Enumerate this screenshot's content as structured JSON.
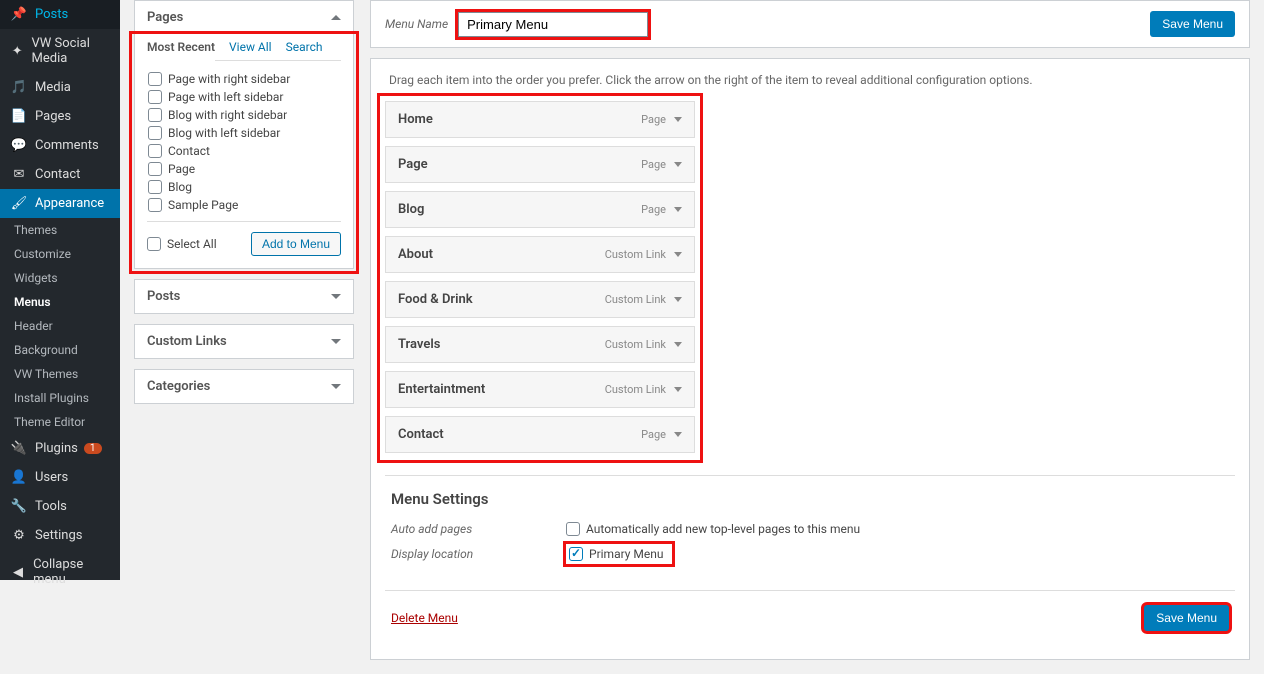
{
  "sidebar": {
    "items": [
      {
        "label": "Posts",
        "icon": "pin"
      },
      {
        "label": "VW Social Media",
        "icon": "star"
      },
      {
        "label": "Media",
        "icon": "media"
      },
      {
        "label": "Pages",
        "icon": "page"
      },
      {
        "label": "Comments",
        "icon": "comment"
      },
      {
        "label": "Contact",
        "icon": "mail"
      },
      {
        "label": "Appearance",
        "icon": "brush",
        "active": true
      },
      {
        "label": "Plugins",
        "icon": "plug",
        "badge": "1"
      },
      {
        "label": "Users",
        "icon": "user"
      },
      {
        "label": "Tools",
        "icon": "wrench"
      },
      {
        "label": "Settings",
        "icon": "gear"
      },
      {
        "label": "Collapse menu",
        "icon": "collapse"
      }
    ],
    "subs": [
      {
        "label": "Themes"
      },
      {
        "label": "Customize"
      },
      {
        "label": "Widgets"
      },
      {
        "label": "Menus",
        "current": true
      },
      {
        "label": "Header"
      },
      {
        "label": "Background"
      },
      {
        "label": "VW Themes"
      },
      {
        "label": "Install Plugins"
      },
      {
        "label": "Theme Editor"
      }
    ]
  },
  "left": {
    "pages_title": "Pages",
    "tabs": {
      "recent": "Most Recent",
      "view_all": "View All",
      "search": "Search"
    },
    "page_items": [
      "Page with right sidebar",
      "Page with left sidebar",
      "Blog with right sidebar",
      "Blog with left sidebar",
      "Contact",
      "Page",
      "Blog",
      "Sample Page"
    ],
    "select_all": "Select All",
    "add_btn": "Add to Menu",
    "other_boxes": [
      "Posts",
      "Custom Links",
      "Categories"
    ]
  },
  "editor": {
    "menu_name_label": "Menu Name",
    "menu_name_value": "Primary Menu",
    "save_label": "Save Menu",
    "instructions": "Drag each item into the order you prefer. Click the arrow on the right of the item to reveal additional configuration options.",
    "items": [
      {
        "title": "Home",
        "type": "Page"
      },
      {
        "title": "Page",
        "type": "Page"
      },
      {
        "title": "Blog",
        "type": "Page"
      },
      {
        "title": "About",
        "type": "Custom Link"
      },
      {
        "title": "Food & Drink",
        "type": "Custom Link"
      },
      {
        "title": "Travels",
        "type": "Custom Link"
      },
      {
        "title": "Entertaintment",
        "type": "Custom Link"
      },
      {
        "title": "Contact",
        "type": "Page"
      }
    ],
    "settings_title": "Menu Settings",
    "auto_add_label": "Auto add pages",
    "auto_add_text": "Automatically add new top-level pages to this menu",
    "location_label": "Display location",
    "location_text": "Primary Menu",
    "delete_label": "Delete Menu"
  }
}
